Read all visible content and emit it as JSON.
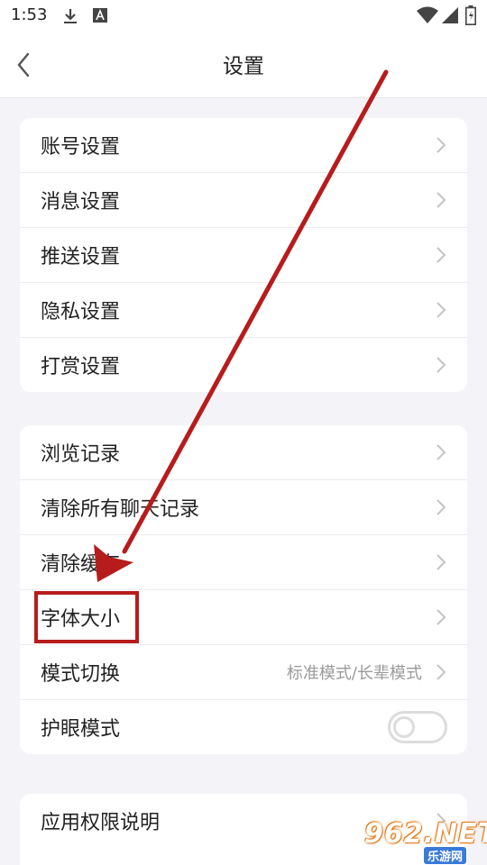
{
  "status_bar": {
    "time": "1:53",
    "icons": [
      "download-icon",
      "notification-a-icon",
      "wifi-icon",
      "signal-icon",
      "battery-icon"
    ]
  },
  "header": {
    "title": "设置",
    "back_icon": "chevron-left-icon"
  },
  "groups": [
    {
      "items": [
        {
          "label": "账号设置"
        },
        {
          "label": "消息设置"
        },
        {
          "label": "推送设置"
        },
        {
          "label": "隐私设置"
        },
        {
          "label": "打赏设置"
        }
      ]
    },
    {
      "items": [
        {
          "label": "浏览记录"
        },
        {
          "label": "清除所有聊天记录"
        },
        {
          "label": "清除缓存"
        },
        {
          "label": "字体大小"
        },
        {
          "label": "模式切换",
          "value": "标准模式/长辈模式"
        },
        {
          "label": "护眼模式",
          "toggle": false
        }
      ]
    },
    {
      "items": [
        {
          "label": "应用权限说明"
        }
      ]
    }
  ],
  "annotation": {
    "color": "#b71c1c",
    "target": "字体大小"
  },
  "watermark": {
    "main": "962.NET",
    "sub": "乐游网"
  }
}
